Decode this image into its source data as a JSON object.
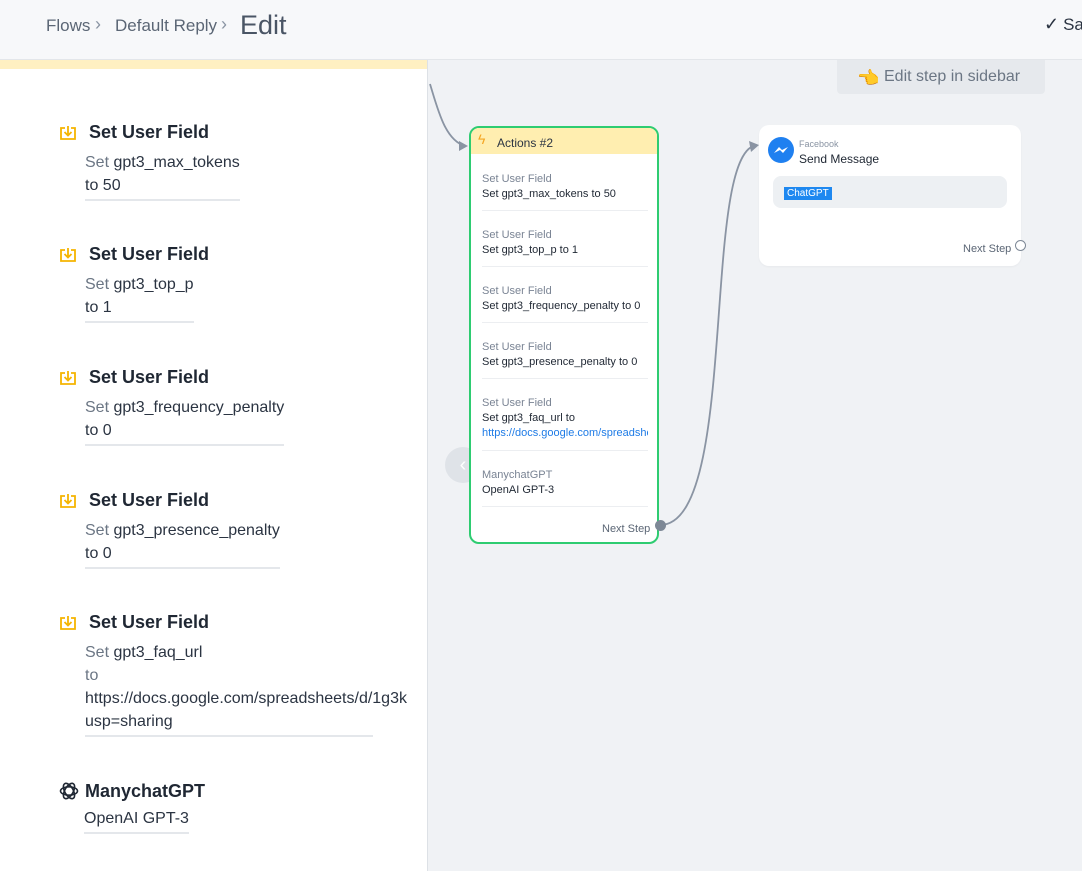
{
  "breadcrumb": {
    "flows": "Flows",
    "default_reply": "Default Reply",
    "edit": "Edit",
    "separator": "›"
  },
  "save_label": "Sa",
  "sidebar": {
    "items": [
      {
        "title": "Set User Field",
        "prefix": "Set",
        "field": "gpt3_max_tokens",
        "value_line": "to 50"
      },
      {
        "title": "Set User Field",
        "prefix": "Set",
        "field": "gpt3_top_p",
        "value_line": "to 1"
      },
      {
        "title": "Set User Field",
        "prefix": "Set",
        "field": "gpt3_frequency_penalty",
        "value_line": "to 0"
      },
      {
        "title": "Set User Field",
        "prefix": "Set",
        "field": "gpt3_presence_penalty",
        "value_line": "to 0"
      },
      {
        "title": "Set User Field",
        "prefix": "Set",
        "field": "gpt3_faq_url",
        "to_word": "to",
        "url_line1": "https://docs.google.com/spreadsheets/d/1g3k",
        "url_line2": "usp=sharing"
      }
    ],
    "gpt": {
      "title": "ManychatGPT",
      "body": "OpenAI GPT-3"
    }
  },
  "canvas": {
    "hint": "Edit step in sidebar",
    "actions_node": {
      "title": "Actions #2",
      "rows": [
        {
          "label": "Set User Field",
          "value": "Set gpt3_max_tokens to 50"
        },
        {
          "label": "Set User Field",
          "value": "Set gpt3_top_p to 1"
        },
        {
          "label": "Set User Field",
          "value": "Set gpt3_frequency_penalty to 0"
        },
        {
          "label": "Set User Field",
          "value": "Set gpt3_presence_penalty to 0"
        },
        {
          "label": "Set User Field",
          "value": "Set gpt3_faq_url to",
          "link": "https://docs.google.com/spreadsheets"
        },
        {
          "label": "ManychatGPT",
          "value": "OpenAI GPT-3"
        }
      ],
      "next_step": "Next Step"
    },
    "message_node": {
      "platform": "Facebook",
      "title": "Send Message",
      "chip": "ChatGPT",
      "next_step": "Next Step"
    }
  },
  "colors": {
    "accent_green": "#2ecc71",
    "header_yellow": "#ffeeb0",
    "link_blue": "#1e7be6",
    "icon_yellow": "#f5b400",
    "messenger_blue": "#1f80f0"
  }
}
